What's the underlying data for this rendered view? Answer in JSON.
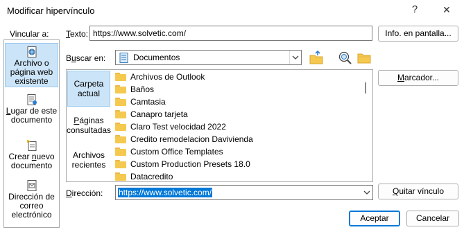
{
  "window": {
    "title": "Modificar hipervínculo",
    "help_glyph": "?",
    "close_glyph": "✕"
  },
  "labels": {
    "vincular": "Vincular a:",
    "texto": "Texto:",
    "buscar_en": "Buscar en:",
    "direccion": "Dirección:"
  },
  "texto_value": "https://www.solvetic.com/",
  "buscar_en_value": "Documentos",
  "direccion_value": "https://www.solvetic.com/",
  "buttons": {
    "info": "Info. en pantalla...",
    "marcador": "Marcador...",
    "quitar": "Quitar vínculo",
    "aceptar": "Aceptar",
    "cancelar": "Cancelar"
  },
  "link_types": [
    {
      "label": "Archivo o página web existente",
      "icon": "web-page-icon"
    },
    {
      "label": "Lugar de este documento",
      "icon": "document-place-icon"
    },
    {
      "label": "Crear nuevo documento",
      "icon": "new-document-icon"
    },
    {
      "label": "Dirección de correo electrónico",
      "icon": "email-icon"
    }
  ],
  "tabs": [
    {
      "label": "Carpeta actual"
    },
    {
      "label": "Páginas consultadas"
    },
    {
      "label": "Archivos recientes"
    }
  ],
  "files": [
    "Archivos de Outlook",
    "Baños",
    "Camtasia",
    "Canapro tarjeta",
    "Claro Test velocidad 2022",
    "Credito remodelacion Davivienda",
    "Custom Office Templates",
    "Custom Production Presets 18.0",
    "Datacredito"
  ],
  "colors": {
    "selection": "#cce4f7",
    "selection_border": "#99c9ef",
    "text_highlight": "#0078d7"
  }
}
